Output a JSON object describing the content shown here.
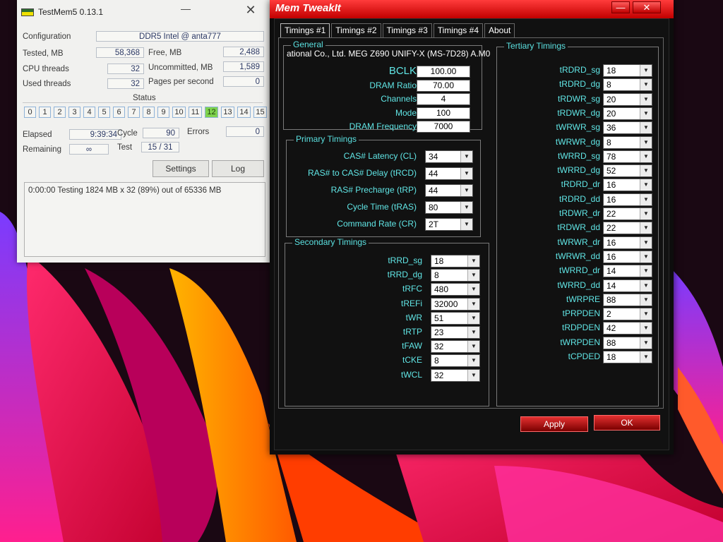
{
  "testmem": {
    "title": "TestMem5  0.13.1",
    "minimize": "—",
    "close": "✕",
    "configuration_label": "Configuration",
    "configuration_value": "DDR5 Intel @ anta777",
    "tested_label": "Tested, MB",
    "tested_value": "58,368",
    "free_label": "Free, MB",
    "free_value": "2,488",
    "cpu_threads_label": "CPU threads",
    "cpu_threads_value": "32",
    "uncommitted_label": "Uncommitted, MB",
    "uncommitted_value": "1,589",
    "used_threads_label": "Used threads",
    "used_threads_value": "32",
    "pages_label": "Pages per second",
    "pages_value": "0",
    "status_label": "Status",
    "status_cells": [
      "0",
      "1",
      "2",
      "3",
      "4",
      "5",
      "6",
      "7",
      "8",
      "9",
      "10",
      "11",
      "12",
      "13",
      "14",
      "15"
    ],
    "active_cell": "12",
    "elapsed_label": "Elapsed",
    "elapsed_value": "9:39:34",
    "cycle_label": "Cycle",
    "cycle_value": "90",
    "errors_label": "Errors",
    "errors_value": "0",
    "remaining_label": "Remaining",
    "remaining_value": "∞",
    "test_label": "Test",
    "test_value": "15 / 31",
    "settings_button": "Settings",
    "log_button": "Log",
    "log_text": "0:00:00  Testing 1824 MB x 32 (89%) out of 65336 MB"
  },
  "memtweakit": {
    "title": "Mem TweakIt",
    "minimize": "—",
    "close": "✕",
    "tabs": [
      "Timings #1",
      "Timings #2",
      "Timings #3",
      "Timings #4",
      "About"
    ],
    "general": {
      "title": "General",
      "board": "ational Co., Ltd. MEG Z690 UNIFY-X (MS-7D28) A.M0",
      "rows": [
        {
          "label": "BCLK",
          "value": "100.00"
        },
        {
          "label": "DRAM Ratio",
          "value": "70.00"
        },
        {
          "label": "Channels",
          "value": "4"
        },
        {
          "label": "Mode",
          "value": "100"
        },
        {
          "label": "DRAM Frequency",
          "value": "7000"
        }
      ]
    },
    "primary": {
      "title": "Primary Timings",
      "rows": [
        {
          "label": "CAS# Latency (CL)",
          "value": "34"
        },
        {
          "label": "RAS# to CAS# Delay (tRCD)",
          "value": "44"
        },
        {
          "label": "RAS# Precharge (tRP)",
          "value": "44"
        },
        {
          "label": "Cycle Time (tRAS)",
          "value": "80"
        },
        {
          "label": "Command Rate (CR)",
          "value": "2T"
        }
      ]
    },
    "secondary": {
      "title": "Secondary Timings",
      "rows": [
        {
          "label": "tRRD_sg",
          "value": "18"
        },
        {
          "label": "tRRD_dg",
          "value": "8"
        },
        {
          "label": "tRFC",
          "value": "480"
        },
        {
          "label": "tREFi",
          "value": "32000"
        },
        {
          "label": "tWR",
          "value": "51"
        },
        {
          "label": "tRTP",
          "value": "23"
        },
        {
          "label": "tFAW",
          "value": "32"
        },
        {
          "label": "tCKE",
          "value": "8"
        },
        {
          "label": "tWCL",
          "value": "32"
        }
      ]
    },
    "tertiary": {
      "title": "Tertiary Timings",
      "rows": [
        {
          "label": "tRDRD_sg",
          "value": "18"
        },
        {
          "label": "tRDRD_dg",
          "value": "8"
        },
        {
          "label": "tRDWR_sg",
          "value": "20"
        },
        {
          "label": "tRDWR_dg",
          "value": "20"
        },
        {
          "label": "tWRWR_sg",
          "value": "36"
        },
        {
          "label": "tWRWR_dg",
          "value": "8"
        },
        {
          "label": "tWRRD_sg",
          "value": "78"
        },
        {
          "label": "tWRRD_dg",
          "value": "52"
        },
        {
          "label": "tRDRD_dr",
          "value": "16"
        },
        {
          "label": "tRDRD_dd",
          "value": "16"
        },
        {
          "label": "tRDWR_dr",
          "value": "22"
        },
        {
          "label": "tRDWR_dd",
          "value": "22"
        },
        {
          "label": "tWRWR_dr",
          "value": "16"
        },
        {
          "label": "tWRWR_dd",
          "value": "16"
        },
        {
          "label": "tWRRD_dr",
          "value": "14"
        },
        {
          "label": "tWRRD_dd",
          "value": "14"
        },
        {
          "label": "tWRPRE",
          "value": "88"
        },
        {
          "label": "tPRPDEN",
          "value": "2"
        },
        {
          "label": "tRDPDEN",
          "value": "42"
        },
        {
          "label": "tWRPDEN",
          "value": "88"
        },
        {
          "label": "tCPDED",
          "value": "18"
        }
      ]
    },
    "apply_button": "Apply",
    "ok_button": "OK"
  }
}
